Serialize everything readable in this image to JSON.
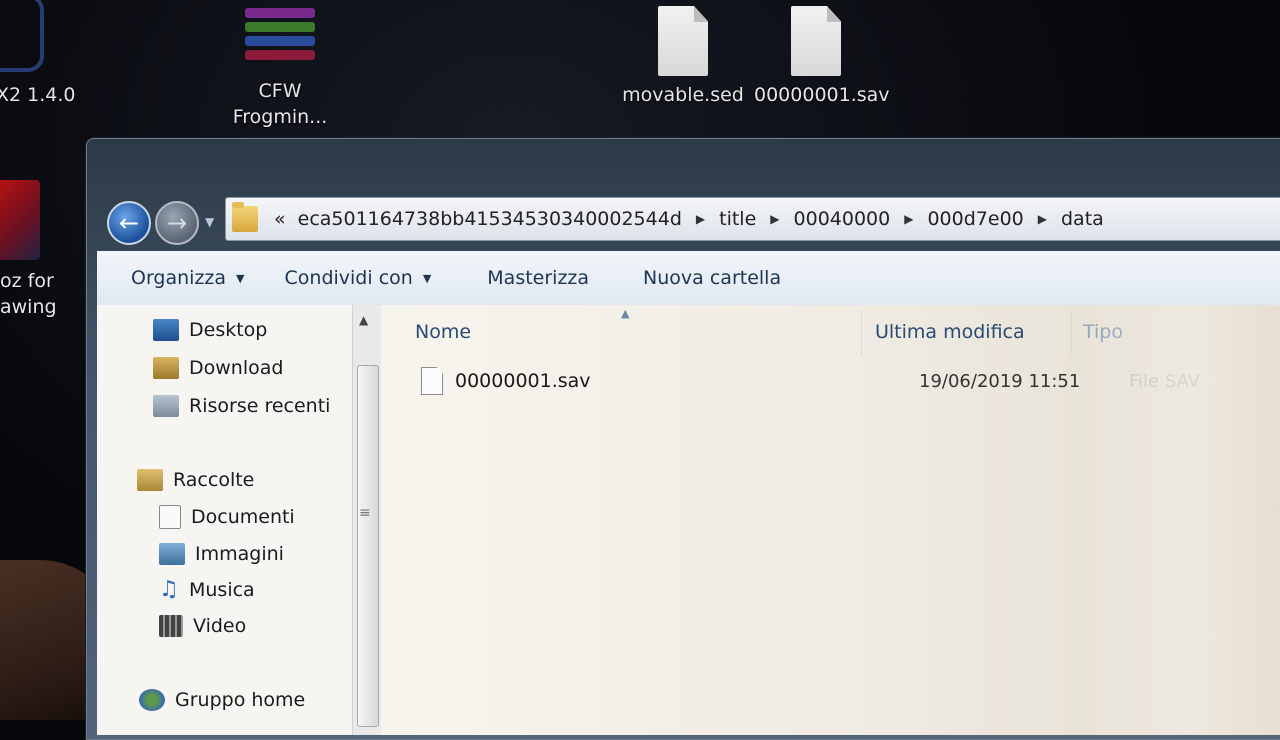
{
  "desktop": {
    "icons": [
      {
        "label_line1": "X2 1.4.0",
        "label_line2": "",
        "icon": "ps2-emulator-icon"
      },
      {
        "label_line1": "CFW",
        "label_line2": "Frogmin...",
        "icon": "winrar-archive-icon"
      },
      {
        "label_line1": "movable.sed",
        "label_line2": "",
        "icon": "file-icon"
      },
      {
        "label_line1": "00000001.sav",
        "label_line2": "",
        "icon": "file-icon"
      },
      {
        "label_line1": "oz for",
        "label_line2": "awing",
        "icon": "app-icon"
      }
    ]
  },
  "explorer": {
    "address": {
      "overflow": "«",
      "crumbs": [
        "eca501164738bb41534530340002544d",
        "title",
        "00040000",
        "000d7e00",
        "data"
      ]
    },
    "toolbar": {
      "organize": "Organizza",
      "share": "Condividi con",
      "burn": "Masterizza",
      "new_folder": "Nuova cartella"
    },
    "nav": {
      "favorites": [
        "Desktop",
        "Download",
        "Risorse recenti"
      ],
      "libraries_header": "Raccolte",
      "libraries": [
        "Documenti",
        "Immagini",
        "Musica",
        "Video"
      ],
      "homegroup": "Gruppo home"
    },
    "columns": {
      "name": "Nome",
      "modified": "Ultima modifica",
      "type": "Tipo"
    },
    "files": [
      {
        "name": "00000001.sav",
        "modified": "19/06/2019 11:51",
        "type": "File SAV"
      }
    ]
  }
}
